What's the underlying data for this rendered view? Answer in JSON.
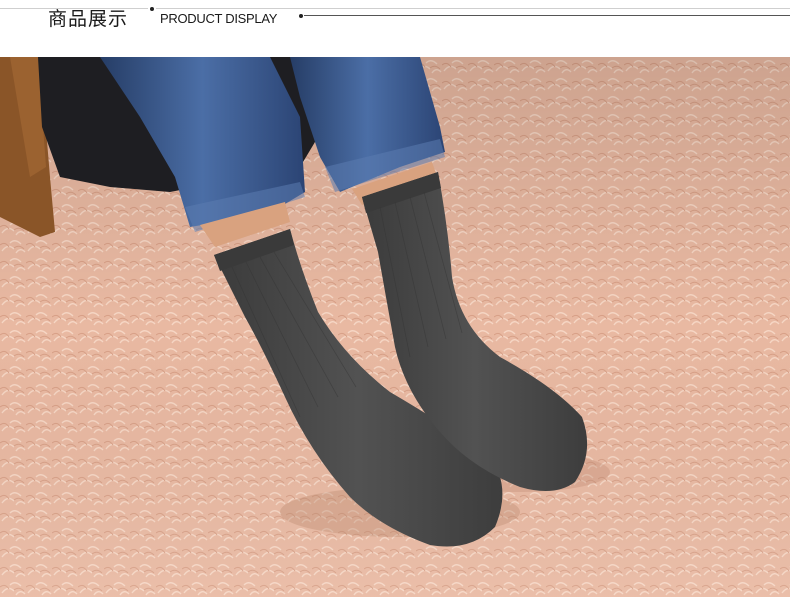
{
  "header": {
    "title_cn": "商品展示",
    "title_en": "PRODUCT DISPLAY"
  },
  "photo": {
    "subject": "dark-grey-socks-on-pink-fluffy-rug",
    "colors": {
      "rug": "#e9b9a2",
      "rug_highlight": "#f6d6c4",
      "rug_shadow": "#d8a087",
      "sock": "#4a4a4a",
      "sock_dark": "#3a3a3a",
      "jeans": "#2f4a78",
      "jeans_light": "#5b7bb0",
      "skin": "#d9a27f",
      "chair": "#1e1e22",
      "bag": "#8a5528"
    }
  }
}
